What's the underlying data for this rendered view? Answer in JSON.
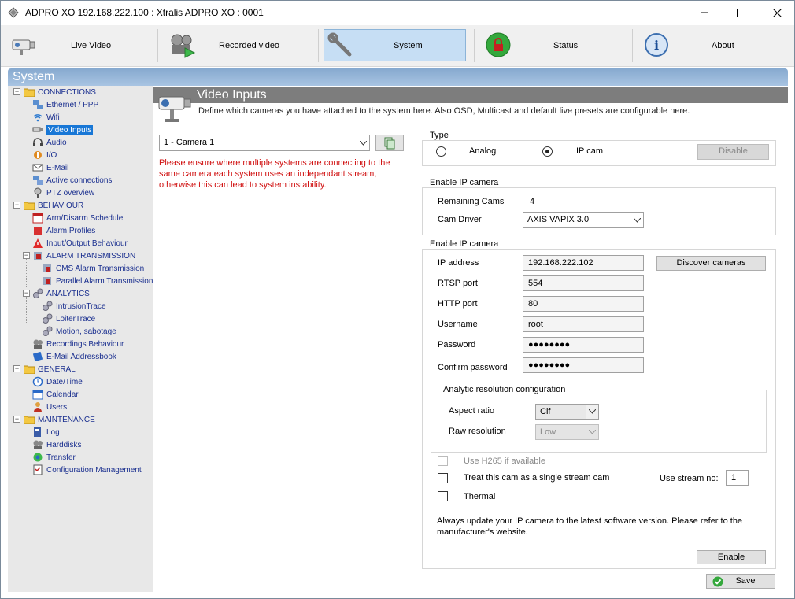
{
  "window": {
    "title": "ADPRO XO  192.168.222.100  :  Xtralis ADPRO XO  :  0001"
  },
  "toolbar": {
    "live_video": "Live Video",
    "recorded_video": "Recorded video",
    "system": "System",
    "status": "Status",
    "about": "About"
  },
  "section_title": "System",
  "tree": {
    "connections": "CONNECTIONS",
    "ethernet": "Ethernet / PPP",
    "wifi": "Wifi",
    "video_inputs": "Video Inputs",
    "audio": "Audio",
    "io": "I/O",
    "email": "E-Mail",
    "active_connections": "Active connections",
    "ptz": "PTZ overview",
    "behaviour": "BEHAVIOUR",
    "arm": "Arm/Disarm Schedule",
    "alarm_profiles": "Alarm Profiles",
    "io_behaviour": "Input/Output Behaviour",
    "alarm_transmission": "ALARM TRANSMISSION",
    "cms": "CMS Alarm Transmission",
    "parallel": "Parallel Alarm Transmission",
    "analytics": "ANALYTICS",
    "intrusion": "IntrusionTrace",
    "loiter": "LoiterTrace",
    "motion": "Motion, sabotage",
    "recordings": "Recordings Behaviour",
    "addressbook": "E-Mail Addressbook",
    "general": "GENERAL",
    "datetime": "Date/Time",
    "calendar": "Calendar",
    "users": "Users",
    "maintenance": "MAINTENANCE",
    "log": "Log",
    "harddisks": "Harddisks",
    "transfer": "Transfer",
    "config_mgmt": "Configuration Management"
  },
  "page": {
    "title": "Video Inputs",
    "description": "Define which cameras you have attached to the system here. Also OSD, Multicast and default live presets are configurable here."
  },
  "camera_select": {
    "value": "1 - Camera 1"
  },
  "warning": {
    "line1": "Please ensure where multiple systems are connecting to the",
    "line2": "same camera each system uses an independant stream,",
    "line3": "otherwise this can lead to system instability."
  },
  "type_group": {
    "label": "Type",
    "analog": "Analog",
    "ipcam": "IP cam",
    "selected": "IP cam",
    "disable": "Disable"
  },
  "enable_group": {
    "label": "Enable IP camera",
    "remaining_label": "Remaining Cams",
    "remaining_value": "4",
    "driver_label": "Cam Driver",
    "driver_value": "AXIS VAPIX 3.0"
  },
  "ip_group": {
    "label": "Enable IP camera",
    "ip_label": "IP address",
    "ip_value": "192.168.222.102",
    "discover": "Discover cameras",
    "rtsp_label": "RTSP port",
    "rtsp_value": "554",
    "http_label": "HTTP port",
    "http_value": "80",
    "user_label": "Username",
    "user_value": "root",
    "pass_label": "Password",
    "pass_value": "●●●●●●●●",
    "confirm_label": "Confirm password",
    "confirm_value": "●●●●●●●●"
  },
  "analytic": {
    "label": "Analytic resolution configuration",
    "aspect_label": "Aspect ratio",
    "aspect_value": "Cif",
    "raw_label": "Raw resolution",
    "raw_value": "Low"
  },
  "options": {
    "h265": "Use H265 if available",
    "single_stream": "Treat this cam as a single stream cam",
    "use_stream_label": "Use stream no:",
    "use_stream_value": "1",
    "thermal": "Thermal"
  },
  "update_note": {
    "line1": "Always update your IP camera to the latest software version. Please refer to the",
    "line2": "manufacturer's website."
  },
  "buttons": {
    "enable": "Enable",
    "save": "Save"
  }
}
